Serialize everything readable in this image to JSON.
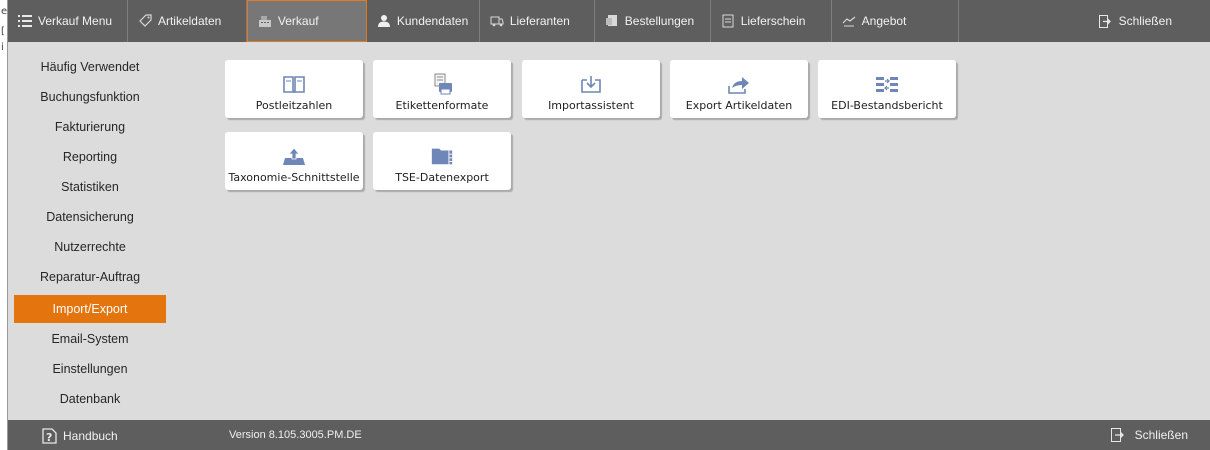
{
  "topbar": {
    "items": [
      {
        "label": "Verkauf Menu",
        "icon": "menu-list-icon"
      },
      {
        "label": "Artikeldaten",
        "icon": "tag-icon"
      },
      {
        "label": "Verkauf",
        "icon": "cash-register-icon",
        "active": true
      },
      {
        "label": "Kundendaten",
        "icon": "customers-icon"
      },
      {
        "label": "Lieferanten",
        "icon": "truck-icon"
      },
      {
        "label": "Bestellungen",
        "icon": "order-icon"
      },
      {
        "label": "Lieferschein",
        "icon": "document-icon"
      },
      {
        "label": "Angebot",
        "icon": "handshake-icon"
      }
    ],
    "close_label": "Schließen"
  },
  "sidebar": {
    "items": [
      {
        "label": "Häufig Verwendet"
      },
      {
        "label": "Buchungsfunktion"
      },
      {
        "label": "Fakturierung"
      },
      {
        "label": "Reporting"
      },
      {
        "label": "Statistiken"
      },
      {
        "label": "Datensicherung"
      },
      {
        "label": "Nutzerrechte"
      },
      {
        "label": "Reparatur-Auftrag"
      },
      {
        "label": "Import/Export",
        "active": true
      },
      {
        "label": "Email-System"
      },
      {
        "label": "Einstellungen"
      },
      {
        "label": "Datenbank"
      }
    ]
  },
  "tiles": [
    {
      "label": "Postleitzahlen",
      "icon": "book-icon"
    },
    {
      "label": "Etikettenformate",
      "icon": "printer-icon"
    },
    {
      "label": "Importassistent",
      "icon": "import-icon"
    },
    {
      "label": "Export Artikeldaten",
      "icon": "export-arrow-icon"
    },
    {
      "label": "EDI-Bestandsbericht",
      "icon": "edi-icon"
    },
    {
      "label": "Taxonomie-Schnittstelle",
      "icon": "upload-tray-icon"
    },
    {
      "label": "TSE-Datenexport",
      "icon": "folder-icon"
    }
  ],
  "bottombar": {
    "handbuch_label": "Handbuch",
    "version": "Version 8.105.3005.PM.DE",
    "close_label": "Schließen"
  },
  "colors": {
    "bar": "#5e5e5e",
    "accent": "#e3740e",
    "background": "#dcdcdc",
    "icon_blue": "#6e86b8"
  }
}
